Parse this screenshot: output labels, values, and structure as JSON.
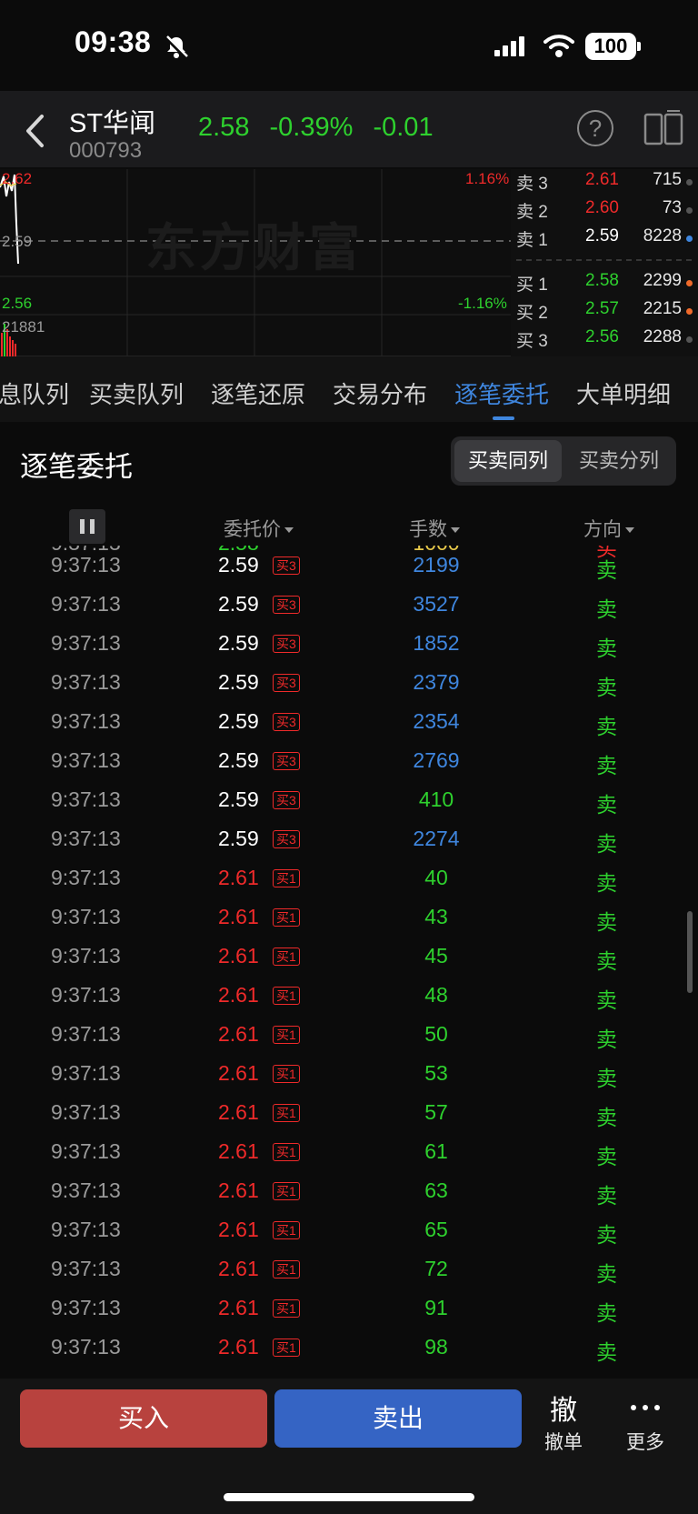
{
  "status_bar": {
    "time": "09:38",
    "battery": "100"
  },
  "header": {
    "stock_name": "ST华闻",
    "stock_code": "000793",
    "price": "2.58",
    "change_pct": "-0.39%",
    "change": "-0.01"
  },
  "chart": {
    "watermark": "东方财富",
    "top_price": "2.62",
    "mid_price": "2.59",
    "low_price": "2.56",
    "top_pct": "1.16%",
    "low_pct": "-1.16%",
    "volume": "21881"
  },
  "order_book": {
    "asks": [
      {
        "label": "卖 3",
        "price": "2.61",
        "volume": "715"
      },
      {
        "label": "卖 2",
        "price": "2.60",
        "volume": "73"
      },
      {
        "label": "卖 1",
        "price": "2.59",
        "volume": "8228"
      }
    ],
    "bids": [
      {
        "label": "买 1",
        "price": "2.58",
        "volume": "2299"
      },
      {
        "label": "买 2",
        "price": "2.57",
        "volume": "2215"
      },
      {
        "label": "买 3",
        "price": "2.56",
        "volume": "2288"
      }
    ]
  },
  "tabs": [
    "息队列",
    "买卖队列",
    "逐笔还原",
    "交易分布",
    "逐笔委托",
    "大单明细"
  ],
  "section": {
    "title": "逐笔委托",
    "toggle": [
      "买卖同列",
      "买卖分列"
    ]
  },
  "table": {
    "headers": {
      "price": "委托价",
      "qty": "手数",
      "dir": "方向"
    },
    "rows": [
      {
        "time": "9:37:13",
        "price": "2.59",
        "badge": "买3",
        "qty": "2199",
        "dir": "卖"
      },
      {
        "time": "9:37:13",
        "price": "2.59",
        "badge": "买3",
        "qty": "3527",
        "dir": "卖"
      },
      {
        "time": "9:37:13",
        "price": "2.59",
        "badge": "买3",
        "qty": "1852",
        "dir": "卖"
      },
      {
        "time": "9:37:13",
        "price": "2.59",
        "badge": "买3",
        "qty": "2379",
        "dir": "卖"
      },
      {
        "time": "9:37:13",
        "price": "2.59",
        "badge": "买3",
        "qty": "2354",
        "dir": "卖"
      },
      {
        "time": "9:37:13",
        "price": "2.59",
        "badge": "买3",
        "qty": "2769",
        "dir": "卖"
      },
      {
        "time": "9:37:13",
        "price": "2.59",
        "badge": "买3",
        "qty": "410",
        "dir": "卖"
      },
      {
        "time": "9:37:13",
        "price": "2.59",
        "badge": "买3",
        "qty": "2274",
        "dir": "卖"
      },
      {
        "time": "9:37:13",
        "price": "2.61",
        "badge": "买1",
        "qty": "40",
        "dir": "卖"
      },
      {
        "time": "9:37:13",
        "price": "2.61",
        "badge": "买1",
        "qty": "43",
        "dir": "卖"
      },
      {
        "time": "9:37:13",
        "price": "2.61",
        "badge": "买1",
        "qty": "45",
        "dir": "卖"
      },
      {
        "time": "9:37:13",
        "price": "2.61",
        "badge": "买1",
        "qty": "48",
        "dir": "卖"
      },
      {
        "time": "9:37:13",
        "price": "2.61",
        "badge": "买1",
        "qty": "50",
        "dir": "卖"
      },
      {
        "time": "9:37:13",
        "price": "2.61",
        "badge": "买1",
        "qty": "53",
        "dir": "卖"
      },
      {
        "time": "9:37:13",
        "price": "2.61",
        "badge": "买1",
        "qty": "57",
        "dir": "卖"
      },
      {
        "time": "9:37:13",
        "price": "2.61",
        "badge": "买1",
        "qty": "61",
        "dir": "卖"
      },
      {
        "time": "9:37:13",
        "price": "2.61",
        "badge": "买1",
        "qty": "63",
        "dir": "卖"
      },
      {
        "time": "9:37:13",
        "price": "2.61",
        "badge": "买1",
        "qty": "65",
        "dir": "卖"
      },
      {
        "time": "9:37:13",
        "price": "2.61",
        "badge": "买1",
        "qty": "72",
        "dir": "卖"
      },
      {
        "time": "9:37:13",
        "price": "2.61",
        "badge": "买1",
        "qty": "91",
        "dir": "卖"
      },
      {
        "time": "9:37:13",
        "price": "2.61",
        "badge": "买1",
        "qty": "98",
        "dir": "卖"
      }
    ]
  },
  "bottom": {
    "buy": "买入",
    "sell": "卖出",
    "cancel_glyph": "撤",
    "cancel": "撤单",
    "more": "更多"
  },
  "colors": {
    "up": "#ef2a2a",
    "down": "#2ed12e",
    "qty_large": "#3f86de",
    "neutral": "#ffffff",
    "accent": "#3f86de"
  }
}
